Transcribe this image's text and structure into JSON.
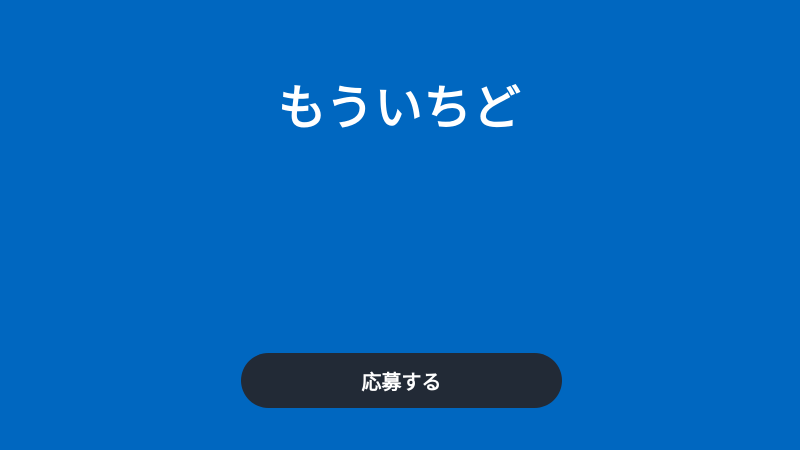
{
  "colors": {
    "background": "#0067c0",
    "button_background": "#222a36",
    "text": "#ffffff"
  },
  "screen": {
    "title": "もういちど"
  },
  "apply_button": {
    "label": "応募する"
  }
}
